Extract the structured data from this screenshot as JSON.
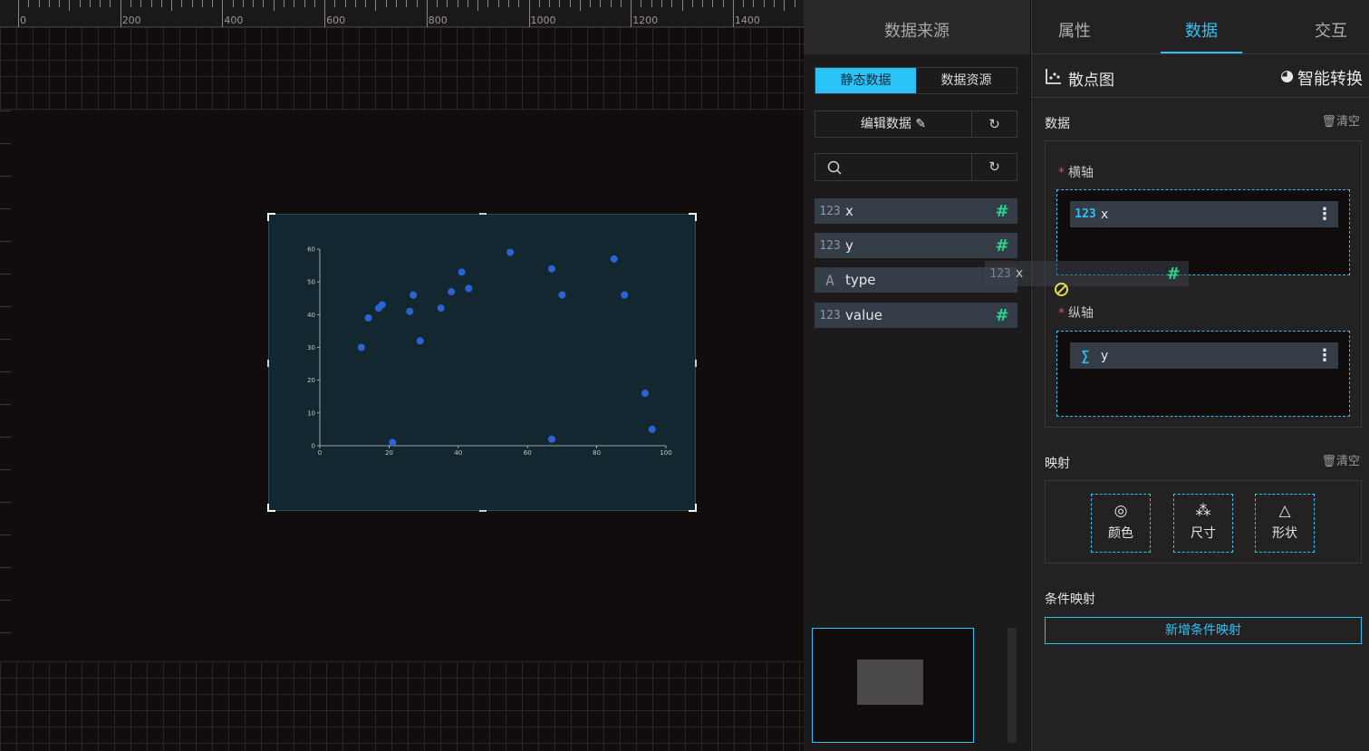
{
  "ruler": {
    "labels": [
      "0",
      "200",
      "400",
      "600",
      "800",
      "1000",
      "1200",
      "1400"
    ]
  },
  "datasource": {
    "title": "数据来源",
    "seg_static": "静态数据",
    "seg_resource": "数据资源",
    "edit_label": "编辑数据 ✎",
    "refresh_glyph": "↻",
    "search_placeholder": "",
    "fields": [
      {
        "type": "123",
        "name": "x"
      },
      {
        "type": "123",
        "name": "y"
      },
      {
        "type": "A",
        "name": "type"
      },
      {
        "type": "123",
        "name": "value"
      }
    ],
    "hash": "#",
    "drag_ghost": {
      "type": "123",
      "name": "x"
    }
  },
  "props": {
    "tabs": [
      "属性",
      "数据",
      "交互"
    ],
    "active_tab": "数据",
    "chart_type": "散点图",
    "smart_convert": "智能转换",
    "data_section": "数据",
    "clear_label": "清空",
    "x_axis_label": "横轴",
    "y_axis_label": "纵轴",
    "x_pill": {
      "type": "123",
      "name": "x"
    },
    "y_pill": {
      "type": "∑",
      "name": "y"
    },
    "mapping_section": "映射",
    "mapping_buttons": [
      "颜色",
      "尺寸",
      "形状"
    ],
    "cond_section": "条件映射",
    "add_cond": "新增条件映射"
  },
  "colors": {
    "accent": "#2bc3f7",
    "field_hash": "#2bd48a",
    "point": "#2b63d4",
    "chart_bg": "#132731"
  },
  "chart_data": {
    "type": "scatter",
    "title": "",
    "xlabel": "",
    "ylabel": "",
    "xlim": [
      0,
      100
    ],
    "ylim": [
      0,
      60
    ],
    "xticks": [
      0,
      20,
      40,
      60,
      80,
      100
    ],
    "yticks": [
      0,
      10,
      20,
      30,
      40,
      50,
      60
    ],
    "grid": false,
    "points": [
      [
        12,
        30
      ],
      [
        14,
        39
      ],
      [
        17,
        42
      ],
      [
        18,
        43
      ],
      [
        21,
        1
      ],
      [
        26,
        41
      ],
      [
        27,
        46
      ],
      [
        29,
        32
      ],
      [
        35,
        42
      ],
      [
        38,
        47
      ],
      [
        41,
        53
      ],
      [
        43,
        48
      ],
      [
        55,
        59
      ],
      [
        67,
        54
      ],
      [
        67,
        2
      ],
      [
        70,
        46
      ],
      [
        85,
        57
      ],
      [
        88,
        46
      ],
      [
        94,
        16
      ],
      [
        96,
        5
      ]
    ]
  }
}
